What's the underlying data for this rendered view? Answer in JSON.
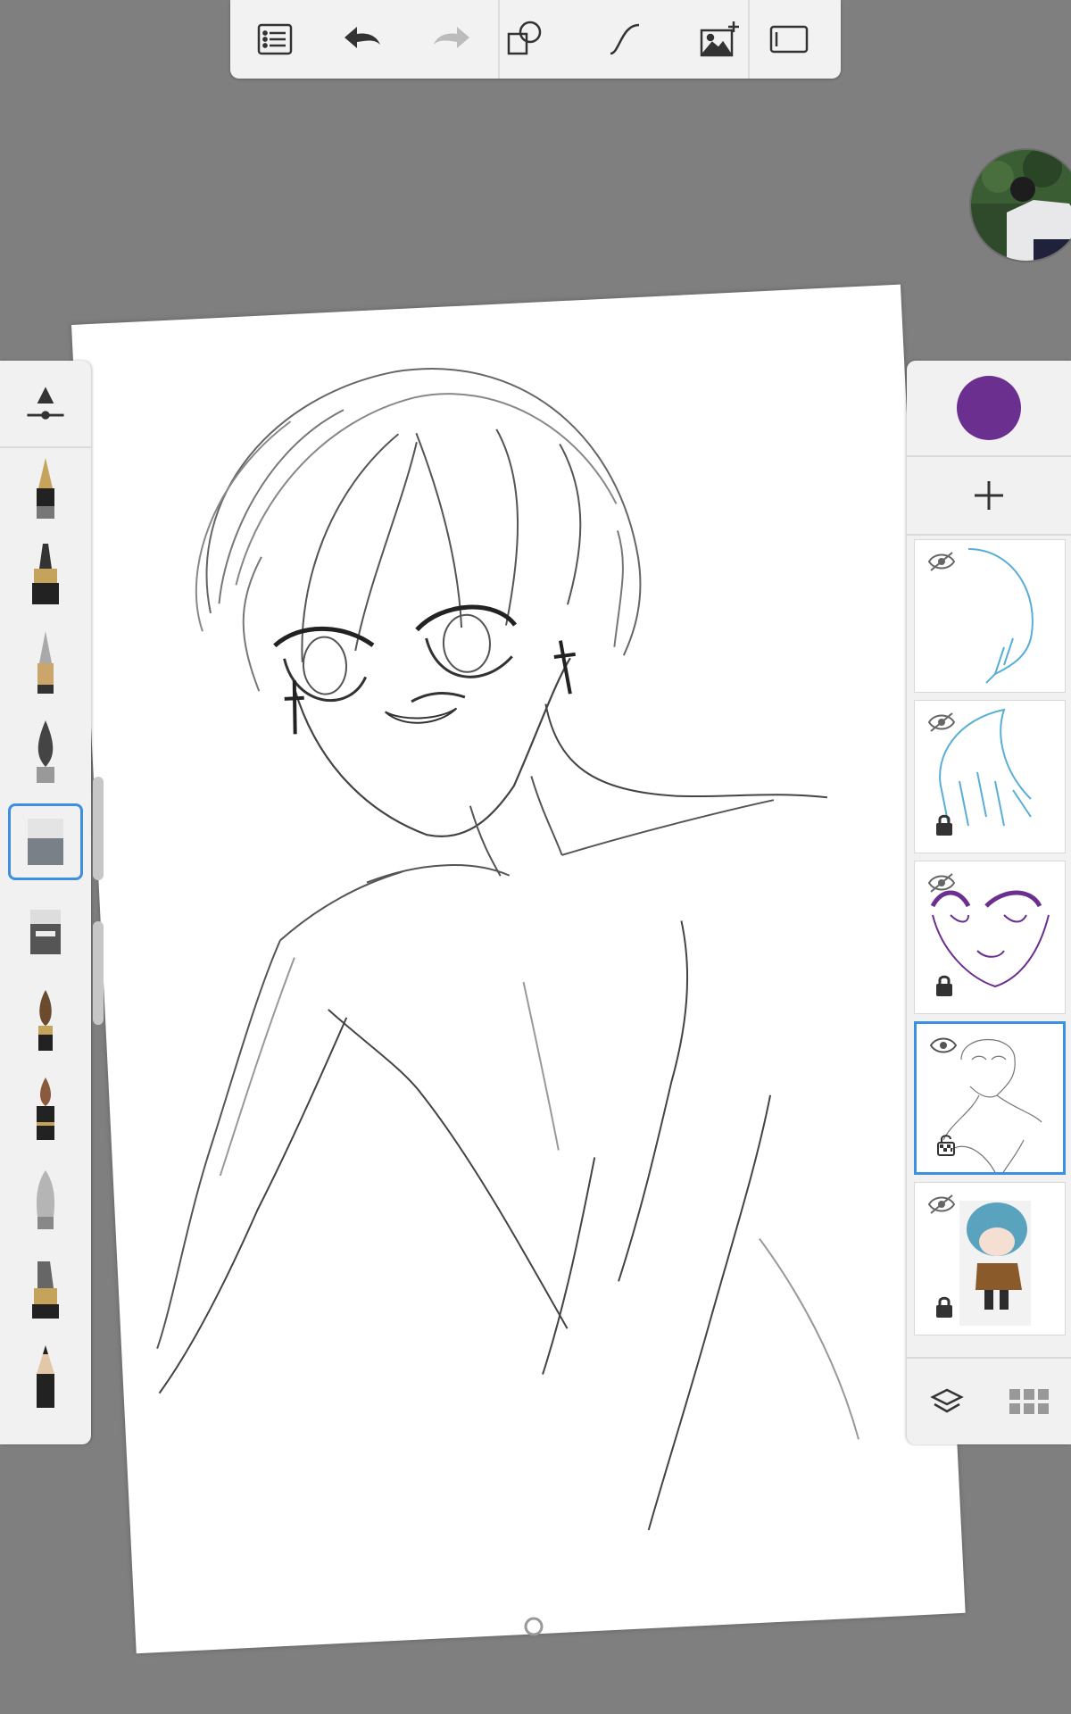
{
  "app": {
    "toolbar": {
      "buttons": [
        {
          "name": "menu-icon"
        },
        {
          "name": "undo-icon"
        },
        {
          "name": "redo-icon",
          "disabled": true
        },
        {
          "name": "shapes-icon"
        },
        {
          "name": "curve-icon"
        },
        {
          "name": "add-image-icon"
        },
        {
          "name": "fullscreen-icon"
        }
      ]
    },
    "brushes": {
      "selected": "eraser",
      "items": [
        "fountain-pen-icon",
        "ink-pen-icon",
        "ballpoint-pen-icon",
        "calligraphy-pen-icon",
        "eraser-icon",
        "soft-eraser-icon",
        "paint-brush-icon",
        "marker-icon",
        "airbrush-icon",
        "chisel-marker-icon",
        "pencil-icon"
      ]
    },
    "layers": {
      "current_color": "#6a2f8f",
      "items": [
        {
          "name": "hair-sketch-layer",
          "visible": false,
          "locked": false
        },
        {
          "name": "hair-color-layer",
          "visible": false,
          "locked": true
        },
        {
          "name": "face-line-layer",
          "visible": false,
          "locked": true
        },
        {
          "name": "body-sketch-layer",
          "visible": true,
          "locked": false,
          "selected": true
        },
        {
          "name": "chibi-reference-layer",
          "visible": false,
          "locked": true
        }
      ]
    },
    "colors": {
      "accent": "#3d8fe0",
      "background": "#7f7f7f",
      "panel": "#f1f1f1"
    }
  }
}
